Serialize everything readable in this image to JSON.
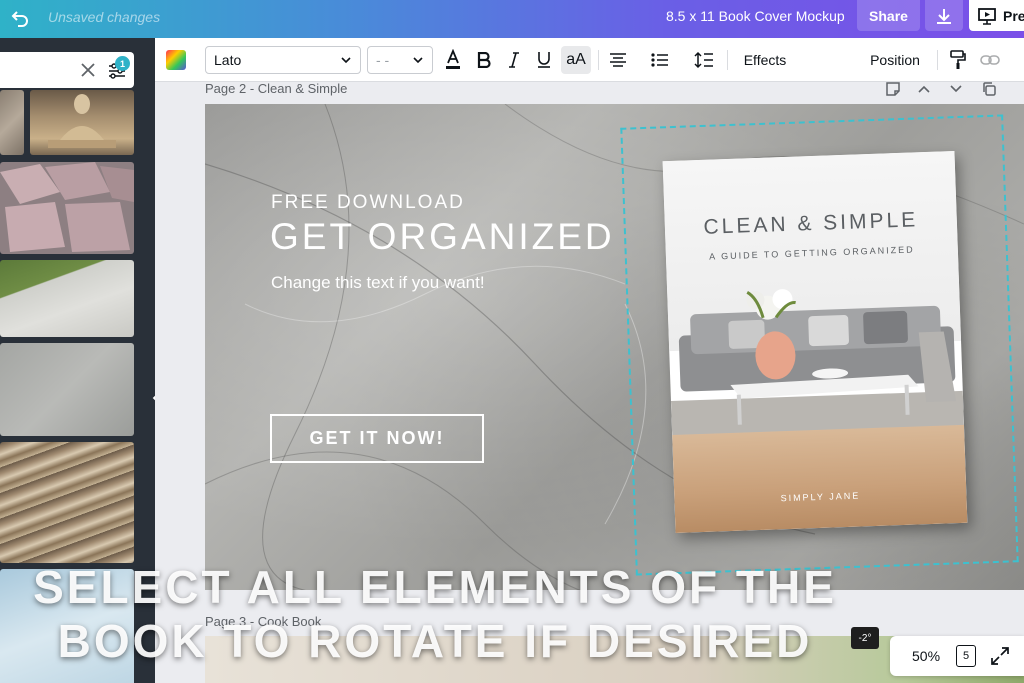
{
  "topbar": {
    "unsaved": "Unsaved changes",
    "doc_title": "8.5 x 11 Book Cover Mockup",
    "share_label": "Share",
    "present_label": "Pre"
  },
  "left_panel": {
    "filter_count": "1"
  },
  "toolbar": {
    "font_family": "Lato",
    "font_size": "- -",
    "case_label": "aA",
    "effects_label": "Effects",
    "position_label": "Position"
  },
  "canvas": {
    "page2_label": "Page 2 - Clean & Simple",
    "page3_label": "Page 3 - Cook Book",
    "kicker": "FREE DOWNLOAD",
    "headline": "GET ORGANIZED",
    "subtext": "Change this text if you want!",
    "cta": "GET IT NOW!",
    "book": {
      "title": "CLEAN & SIMPLE",
      "subtitle": "A GUIDE TO GETTING ORGANIZED",
      "author": "SIMPLY JANE"
    },
    "rotation_badge": "-2°"
  },
  "footer": {
    "zoom": "50%",
    "page_count": "5"
  },
  "overlay": {
    "line1": "SELECT ALL ELEMENTS OF THE",
    "line2": "BOOK TO ROTATE IF DESIRED"
  },
  "colors": {
    "accent": "#3dc1cf",
    "panel_bg": "#293039",
    "gradient_start": "#2fb2c8",
    "gradient_end": "#7b4fe8"
  }
}
